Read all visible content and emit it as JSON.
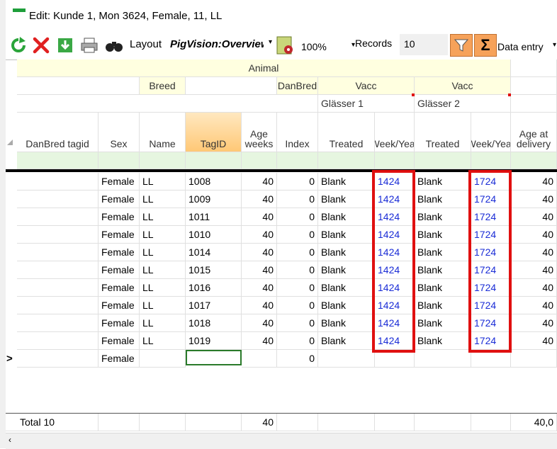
{
  "window": {
    "title": "Edit: Kunde 1, Mon 3624, Female, 11, LL"
  },
  "toolbar": {
    "layout_label": "Layout",
    "layout_value": "PigVision:Overview",
    "zoom_value": "100%",
    "records_label": "Records",
    "records_value": "10",
    "data_entry_label": "Data entry"
  },
  "grid": {
    "group_header_animal": "Animal",
    "group_header_breed": "Breed",
    "group_header_danbred": "DanBred",
    "group_header_vacc1": "Vacc",
    "group_header_vacc2": "Vacc",
    "sub_header_vacc1": "Glässer 1",
    "sub_header_vacc2": "Glässer 2",
    "columns": [
      "DanBred tagid",
      "Sex",
      "Name",
      "TagID",
      "Age weeks",
      "Index",
      "Treated",
      "Week/Year",
      "Treated",
      "Week/Year",
      "Age at delivery"
    ],
    "rows": [
      [
        "",
        "Female",
        "LL",
        "1008",
        "40",
        "0",
        "Blank",
        "1424",
        "Blank",
        "1724",
        "40"
      ],
      [
        "",
        "Female",
        "LL",
        "1009",
        "40",
        "0",
        "Blank",
        "1424",
        "Blank",
        "1724",
        "40"
      ],
      [
        "",
        "Female",
        "LL",
        "1011",
        "40",
        "0",
        "Blank",
        "1424",
        "Blank",
        "1724",
        "40"
      ],
      [
        "",
        "Female",
        "LL",
        "1010",
        "40",
        "0",
        "Blank",
        "1424",
        "Blank",
        "1724",
        "40"
      ],
      [
        "",
        "Female",
        "LL",
        "1014",
        "40",
        "0",
        "Blank",
        "1424",
        "Blank",
        "1724",
        "40"
      ],
      [
        "",
        "Female",
        "LL",
        "1015",
        "40",
        "0",
        "Blank",
        "1424",
        "Blank",
        "1724",
        "40"
      ],
      [
        "",
        "Female",
        "LL",
        "1016",
        "40",
        "0",
        "Blank",
        "1424",
        "Blank",
        "1724",
        "40"
      ],
      [
        "",
        "Female",
        "LL",
        "1017",
        "40",
        "0",
        "Blank",
        "1424",
        "Blank",
        "1724",
        "40"
      ],
      [
        "",
        "Female",
        "LL",
        "1018",
        "40",
        "0",
        "Blank",
        "1424",
        "Blank",
        "1724",
        "40"
      ],
      [
        "",
        "Female",
        "LL",
        "1019",
        "40",
        "0",
        "Blank",
        "1424",
        "Blank",
        "1724",
        "40"
      ]
    ],
    "new_row": {
      "marker": ">",
      "sex": "Female",
      "index": "0"
    },
    "totals": {
      "label": "Total 10",
      "age_weeks": "40",
      "age_at_delivery": "40,0"
    }
  },
  "colors": {
    "highlight_box": "#e01010",
    "link_blue": "#1a2cd6",
    "selected_header": "#ffc876",
    "filter_active": "#f6a25a"
  }
}
